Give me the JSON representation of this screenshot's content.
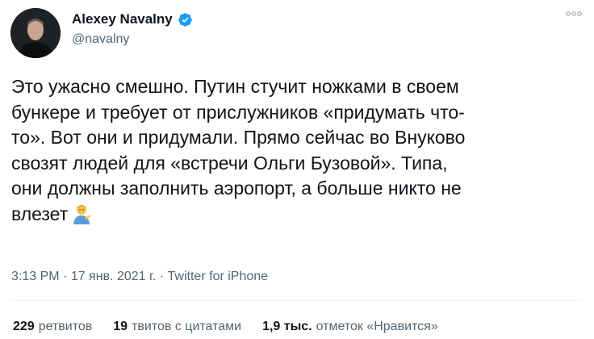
{
  "author": {
    "name": "Alexey Navalny",
    "handle": "@navalny"
  },
  "tweet": {
    "lines": [
      "Это ужасно смешно. Путин стучит ножками в своем",
      "бункере и требует от прислужников «придумать что-",
      "то». Вот они и придумали. Прямо сейчас во Внуково",
      "свозят людей для «встречи Ольги Бузовой». Типа,",
      "они должны заполнить аэропорт, а больше никто не",
      "влезет"
    ],
    "emoji": "man-tipping-hand-icon"
  },
  "meta": {
    "time": "3:13 PM",
    "separator1": " · ",
    "date": "17 янв. 2021 г.",
    "separator2": " · ",
    "source": "Twitter for iPhone"
  },
  "stats": [
    {
      "count": "229",
      "label": "ретвитов"
    },
    {
      "count": "19",
      "label": "твитов с цитатами"
    },
    {
      "count": "1,9 тыс.",
      "label": "отметок «Нравится»"
    }
  ],
  "colors": {
    "text": "#0f1419",
    "secondary": "#536471",
    "verified": "#1d9bf0"
  },
  "more_icon": "more-dots-icon"
}
